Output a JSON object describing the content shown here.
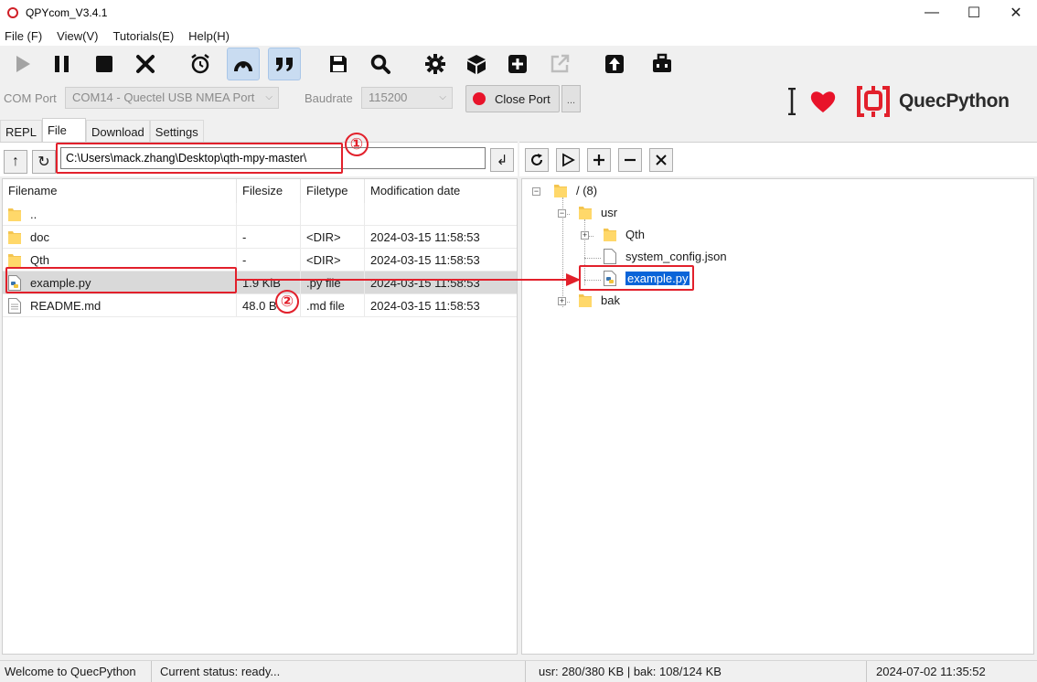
{
  "window": {
    "title": "QPYcom_V3.4.1"
  },
  "menu": [
    {
      "label": "File (F)"
    },
    {
      "label": "View(V)"
    },
    {
      "label": "Tutorials(E)"
    },
    {
      "label": "Help(H)"
    }
  ],
  "toolbar": {
    "icons": [
      "play-icon",
      "pause-icon",
      "stop-icon",
      "close-x-icon",
      "alarm-clock-icon",
      "arc-icon",
      "quote-icon",
      "save-disk-icon",
      "search-icon",
      "gear-icon",
      "cube-icon",
      "plus-box-icon",
      "external-link-icon",
      "upload-arrow-icon",
      "toolbox-icon"
    ]
  },
  "port": {
    "com_label": "COM Port",
    "com_value": "COM14 - Quectel USB NMEA Port",
    "baud_label": "Baudrate",
    "baud_value": "115200",
    "close_label": "Close Port",
    "more_label": "..."
  },
  "brand": {
    "logo_text": "QuecPython",
    "accent": "#e2202b"
  },
  "tabs": [
    {
      "label": "REPL"
    },
    {
      "label": "File"
    },
    {
      "label": "Download"
    },
    {
      "label": "Settings"
    }
  ],
  "local": {
    "path": "C:\\Users\\mack.zhang\\Desktop\\qth-mpy-master\\",
    "columns": [
      "Filename",
      "Filesize",
      "Filetype",
      "Modification date"
    ],
    "rows": [
      {
        "name": "..",
        "size": "",
        "type": "",
        "date": "",
        "icon": "folder"
      },
      {
        "name": "doc",
        "size": "-",
        "type": "<DIR>",
        "date": "2024-03-15 11:58:53",
        "icon": "folder"
      },
      {
        "name": "Qth",
        "size": "-",
        "type": "<DIR>",
        "date": "2024-03-15 11:58:53",
        "icon": "folder"
      },
      {
        "name": "example.py",
        "size": "1.9 KiB",
        "type": ".py file",
        "date": "2024-03-15 11:58:53",
        "icon": "python"
      },
      {
        "name": "README.md",
        "size": "48.0 B",
        "type": ".md file",
        "date": "2024-03-15 11:58:53",
        "icon": "file"
      }
    ]
  },
  "device": {
    "root": "/ (8)",
    "usr": "usr",
    "qth": "Qth",
    "system_config": "system_config.json",
    "example": "example.py",
    "bak": "bak"
  },
  "annotations": {
    "step1": "①",
    "step2": "②"
  },
  "status": {
    "welcome": "Welcome to QuecPython",
    "current": "Current status: ready...",
    "storage": "usr: 280/380 KB | bak: 108/124 KB",
    "datetime": "2024-07-02 11:35:52"
  }
}
